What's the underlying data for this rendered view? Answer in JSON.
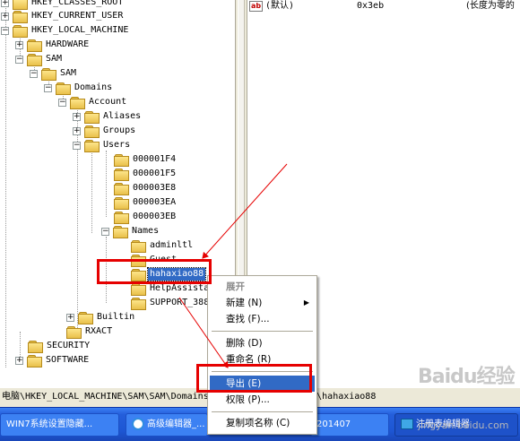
{
  "tree": {
    "nodes": [
      {
        "label": "HKEY_CLASSES_ROOT",
        "expander": "+"
      },
      {
        "label": "HKEY_CURRENT_USER",
        "expander": "+"
      },
      {
        "label": "HKEY_LOCAL_MACHINE",
        "expander": "−"
      },
      {
        "label": "HARDWARE",
        "expander": "+"
      },
      {
        "label": "SAM",
        "expander": "−"
      },
      {
        "label": "SAM",
        "expander": "−"
      },
      {
        "label": "Domains",
        "expander": "−"
      },
      {
        "label": "Account",
        "expander": "−"
      },
      {
        "label": "Aliases",
        "expander": "+"
      },
      {
        "label": "Groups",
        "expander": "+"
      },
      {
        "label": "Users",
        "expander": "−"
      },
      {
        "label": "000001F4",
        "expander": ""
      },
      {
        "label": "000001F5",
        "expander": ""
      },
      {
        "label": "000003E8",
        "expander": ""
      },
      {
        "label": "000003EA",
        "expander": ""
      },
      {
        "label": "000003EB",
        "expander": ""
      },
      {
        "label": "Names",
        "expander": "−"
      },
      {
        "label": "adminltl",
        "expander": ""
      },
      {
        "label": "Guest",
        "expander": ""
      },
      {
        "label": "hahaxiao88",
        "expander": ""
      },
      {
        "label": "HelpAssista",
        "expander": ""
      },
      {
        "label": "SUPPORT_388",
        "expander": ""
      },
      {
        "label": "Builtin",
        "expander": "+"
      },
      {
        "label": "RXACT",
        "expander": ""
      },
      {
        "label": "SECURITY",
        "expander": ""
      },
      {
        "label": "SOFTWARE",
        "expander": "+"
      }
    ]
  },
  "values_pane": {
    "row": {
      "icon": "ab",
      "name": "(默认)",
      "data": "0x3eb",
      "type": "(长度为零的"
    }
  },
  "context_menu": {
    "items": [
      {
        "label": "展开"
      },
      {
        "label": "新建 (N)"
      },
      {
        "label": "查找 (F)..."
      },
      {
        "label": "删除 (D)"
      },
      {
        "label": "重命名 (R)"
      },
      {
        "label": "导出 (E)"
      },
      {
        "label": "权限 (P)..."
      },
      {
        "label": "复制项名称 (C)"
      }
    ],
    "submenu_arrow": "▶"
  },
  "status_bar": {
    "text": "电脑\\HKEY_LOCAL_MACHINE\\SAM\\SAM\\Domains\\Account\\Users\\Names\\hahaxiao88"
  },
  "taskbar": {
    "items": [
      {
        "label": "WIN7系统设置隐藏..."
      },
      {
        "label": "高级编辑器_..."
      },
      {
        "label": "201407"
      },
      {
        "label": "注册表编辑器"
      }
    ]
  },
  "watermark": {
    "brand": "Baidu经验",
    "sub": "jingyan.baidu.com"
  },
  "colors": {
    "selection": "#316ac5",
    "annotation_red": "#e60000",
    "taskbar_blue": "#245edb"
  }
}
